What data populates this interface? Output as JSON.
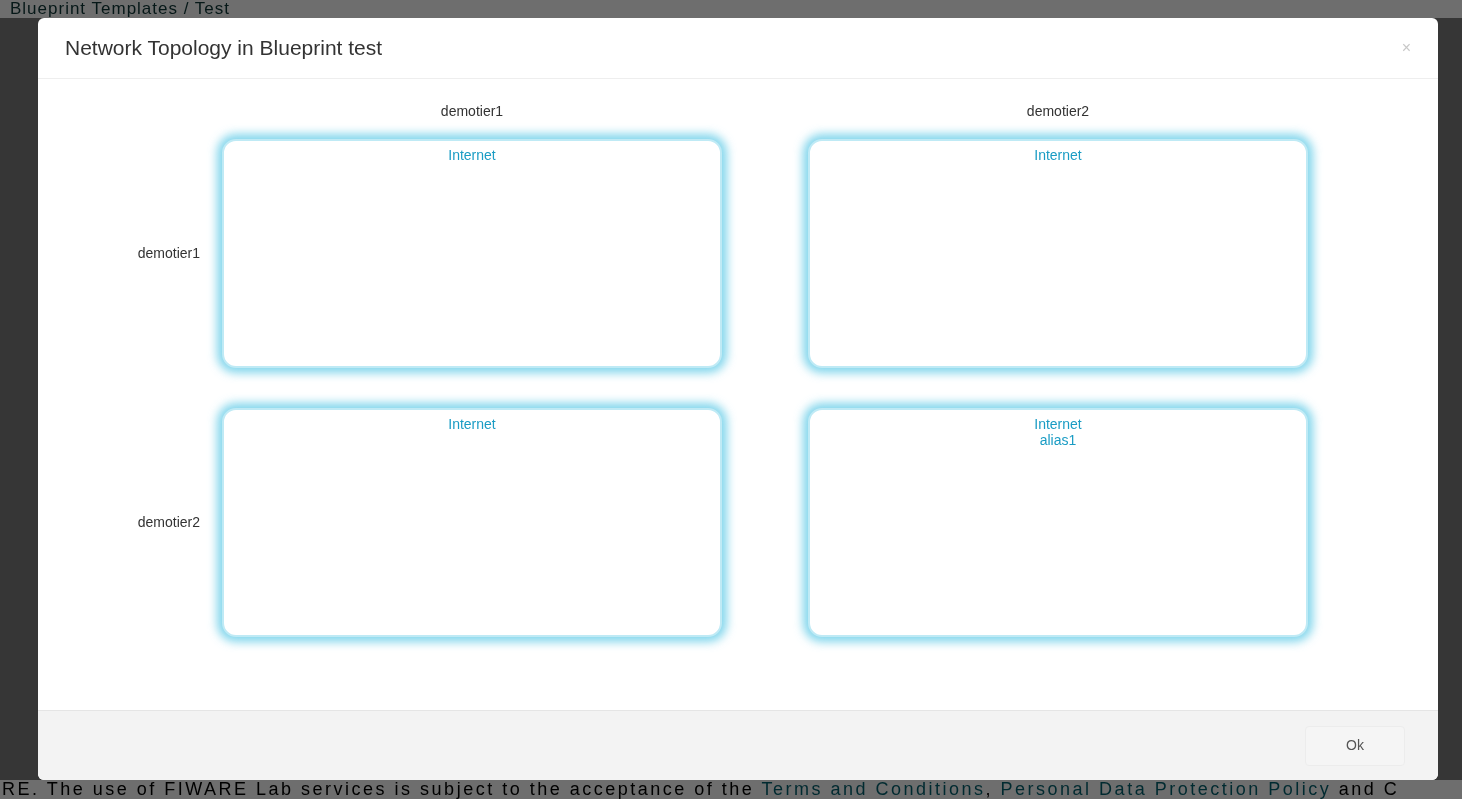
{
  "page": {
    "title": "Blueprint Templates / Test",
    "footer": {
      "text": "RE. The use of FIWARE Lab services is subject to the acceptance of the ",
      "links": [
        "Terms and Conditions",
        "Personal Data Protection Policy"
      ],
      "separator": ", ",
      "tail": " and C"
    }
  },
  "dialog": {
    "title": "Network Topology in Blueprint test",
    "close": "×",
    "columns": [
      "demotier1",
      "demotier2"
    ],
    "rows": [
      {
        "label": "demotier1",
        "cells": [
          {
            "lines": [
              "Internet"
            ]
          },
          {
            "lines": [
              "Internet"
            ]
          }
        ]
      },
      {
        "label": "demotier2",
        "cells": [
          {
            "lines": [
              "Internet"
            ]
          },
          {
            "lines": [
              "Internet",
              "alias1"
            ]
          }
        ]
      }
    ],
    "buttons": [
      "Ok"
    ]
  }
}
